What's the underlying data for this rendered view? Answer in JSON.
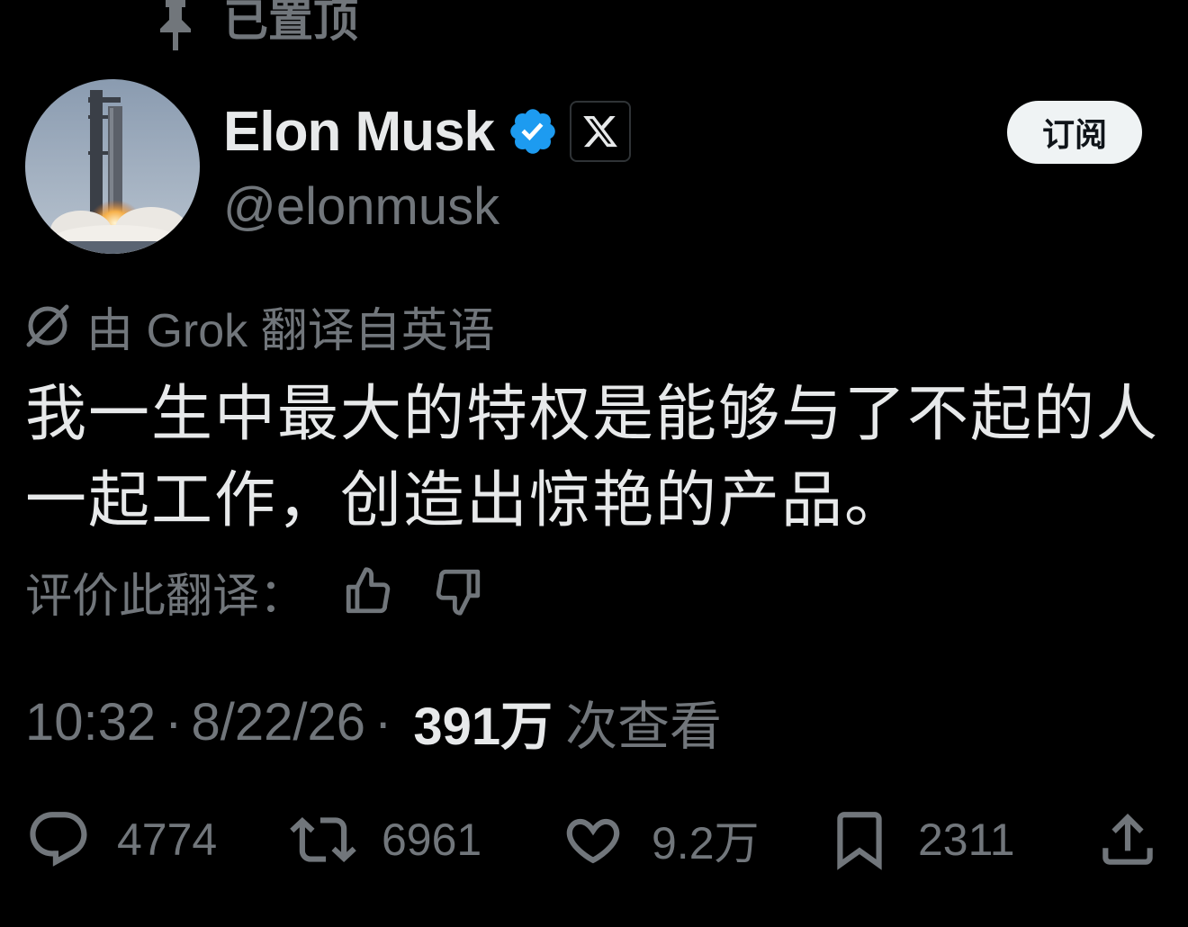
{
  "pinned": {
    "label": "已置顶",
    "icon": "pin-icon"
  },
  "author": {
    "display_name": "Elon Musk",
    "handle": "@elonmusk",
    "verified_color": "#1d9bf0",
    "affiliate_badge": "X"
  },
  "subscribe": {
    "label": "订阅"
  },
  "translation": {
    "notice": "由 Grok 翻译自英语",
    "rate_label": "评价此翻译："
  },
  "tweet": {
    "text": "我一生中最大的特权是能够与了不起的人一起工作，创造出惊艳的产品。"
  },
  "meta": {
    "time": "10:32",
    "date": "8/22/26",
    "separator": "·",
    "views_count": "391万",
    "views_label": "次查看"
  },
  "actions": {
    "replies": "4774",
    "reposts": "6961",
    "likes": "9.2万",
    "bookmarks": "2311"
  },
  "colors": {
    "background": "#000000",
    "primary_text": "#e7e9ea",
    "secondary_text": "#71767b",
    "button_bg": "#eff3f4"
  }
}
